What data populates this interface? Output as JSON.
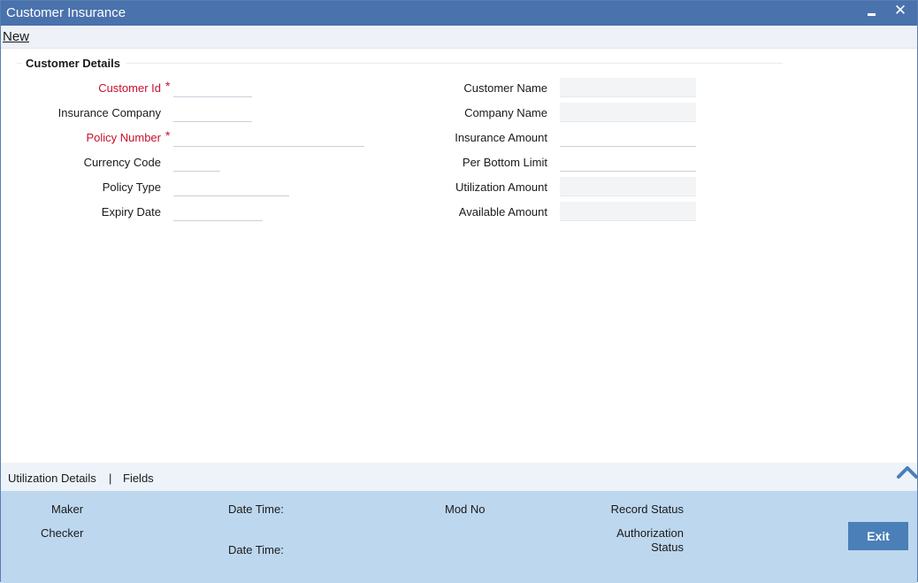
{
  "window": {
    "title": "Customer Insurance",
    "close_glyph": "✕"
  },
  "menu": {
    "new_label": "New"
  },
  "section": {
    "title": "Customer Details"
  },
  "left_fields": {
    "customer_id": {
      "label": "Customer Id",
      "value": ""
    },
    "insurance_company": {
      "label": "Insurance Company",
      "value": ""
    },
    "policy_number": {
      "label": "Policy Number",
      "value": ""
    },
    "currency_code": {
      "label": "Currency Code",
      "value": ""
    },
    "policy_type": {
      "label": "Policy Type",
      "value": ""
    },
    "expiry_date": {
      "label": "Expiry Date",
      "value": ""
    }
  },
  "right_fields": {
    "customer_name": {
      "label": "Customer Name",
      "value": ""
    },
    "company_name": {
      "label": "Company Name",
      "value": ""
    },
    "insurance_amount": {
      "label": "Insurance Amount",
      "value": ""
    },
    "per_bottom_limit": {
      "label": "Per Bottom Limit",
      "value": ""
    },
    "utilization_amount": {
      "label": "Utilization Amount",
      "value": ""
    },
    "available_amount": {
      "label": "Available Amount",
      "value": ""
    }
  },
  "required_marker": "*",
  "tabs": {
    "utilization_details": "Utilization Details",
    "separator": "|",
    "fields": "Fields"
  },
  "footer": {
    "maker": "Maker",
    "checker": "Checker",
    "date_time_1": "Date Time:",
    "date_time_2": "Date Time:",
    "mod_no": "Mod No",
    "record_status": "Record Status",
    "authorization": "Authorization",
    "status": "Status",
    "exit": "Exit"
  },
  "colors": {
    "titlebar": "#4a72ad",
    "required": "#c8102e",
    "footer": "#bdd7ee",
    "exit_button": "#4a7fb8"
  },
  "icons": {
    "minimize": "minimize-icon",
    "close": "close-icon",
    "collapse": "chevron-up-icon"
  }
}
